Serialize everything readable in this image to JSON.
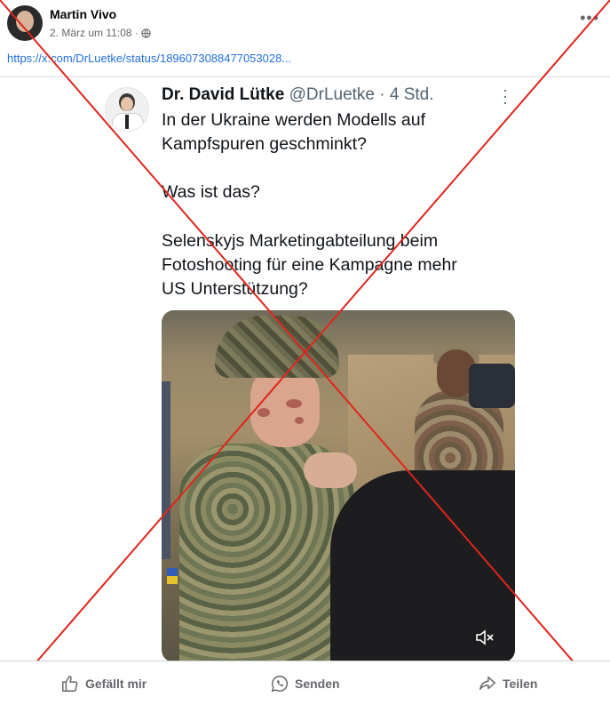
{
  "post": {
    "author": "Martin Vivo",
    "date": "2. März um 11:08 ·",
    "link": "https://x.com/DrLuetke/status/1896073088477053028...",
    "more_icon": "more-horizontal-icon"
  },
  "tweet": {
    "name": "Dr. David Lütke",
    "handle": "@DrLuetke · 4 Std.",
    "lines": [
      "In der Ukraine werden Modells auf",
      "Kampfspuren geschminkt?",
      "Was ist das?",
      "Selenskyjs Marketingabteilung beim",
      "Fotoshooting für eine Kampagne mehr",
      "US Unterstützung?"
    ]
  },
  "actions": {
    "like": "Gefällt mir",
    "send": "Senden",
    "share": "Teilen"
  },
  "colors": {
    "cross": "#e0251b",
    "link": "#216fdb",
    "muted_text": "#65676b"
  }
}
